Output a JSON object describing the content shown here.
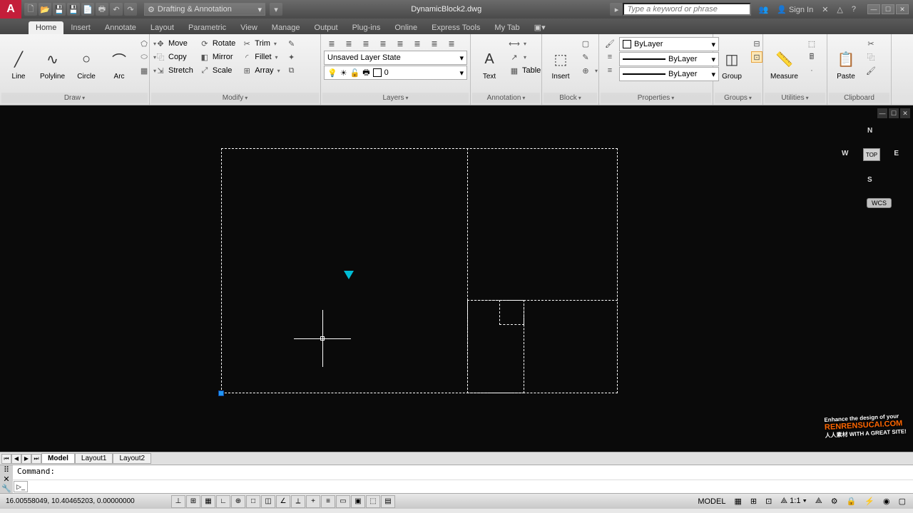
{
  "title": "DynamicBlock2.dwg",
  "workspace": "Drafting & Annotation",
  "search_placeholder": "Type a keyword or phrase",
  "signin": "Sign In",
  "tabs": [
    "Home",
    "Insert",
    "Annotate",
    "Layout",
    "Parametric",
    "View",
    "Manage",
    "Output",
    "Plug-ins",
    "Online",
    "Express Tools",
    "My Tab"
  ],
  "active_tab": "Home",
  "panels": {
    "draw": {
      "title": "Draw",
      "items": [
        "Line",
        "Polyline",
        "Circle",
        "Arc"
      ]
    },
    "modify": {
      "title": "Modify",
      "move": "Move",
      "rotate": "Rotate",
      "trim": "Trim",
      "copy": "Copy",
      "mirror": "Mirror",
      "fillet": "Fillet",
      "stretch": "Stretch",
      "scale": "Scale",
      "array": "Array"
    },
    "layers": {
      "title": "Layers",
      "state": "Unsaved Layer State",
      "current": "0"
    },
    "annotation": {
      "title": "Annotation",
      "text": "Text",
      "table": "Table"
    },
    "block": {
      "title": "Block",
      "insert": "Insert"
    },
    "properties": {
      "title": "Properties",
      "color": "ByLayer",
      "line": "ByLayer",
      "weight": "ByLayer"
    },
    "groups": {
      "title": "Groups",
      "group": "Group"
    },
    "utilities": {
      "title": "Utilities",
      "measure": "Measure"
    },
    "clipboard": {
      "title": "Clipboard",
      "paste": "Paste"
    }
  },
  "viewcube": {
    "top": "TOP",
    "n": "N",
    "s": "S",
    "e": "E",
    "w": "W",
    "wcs": "WCS"
  },
  "layout_tabs": [
    "Model",
    "Layout1",
    "Layout2"
  ],
  "active_layout": "Model",
  "command_history": "Command:",
  "coords": "16.00558049, 10.40465203, 0.00000000",
  "status_right": {
    "model": "MODEL",
    "scale": "1:1"
  },
  "watermark": {
    "line1": "Enhance the design of your",
    "line2": "RENRENSUCAI.COM",
    "line3": "人人素材 WITH A GREAT SITE!"
  }
}
